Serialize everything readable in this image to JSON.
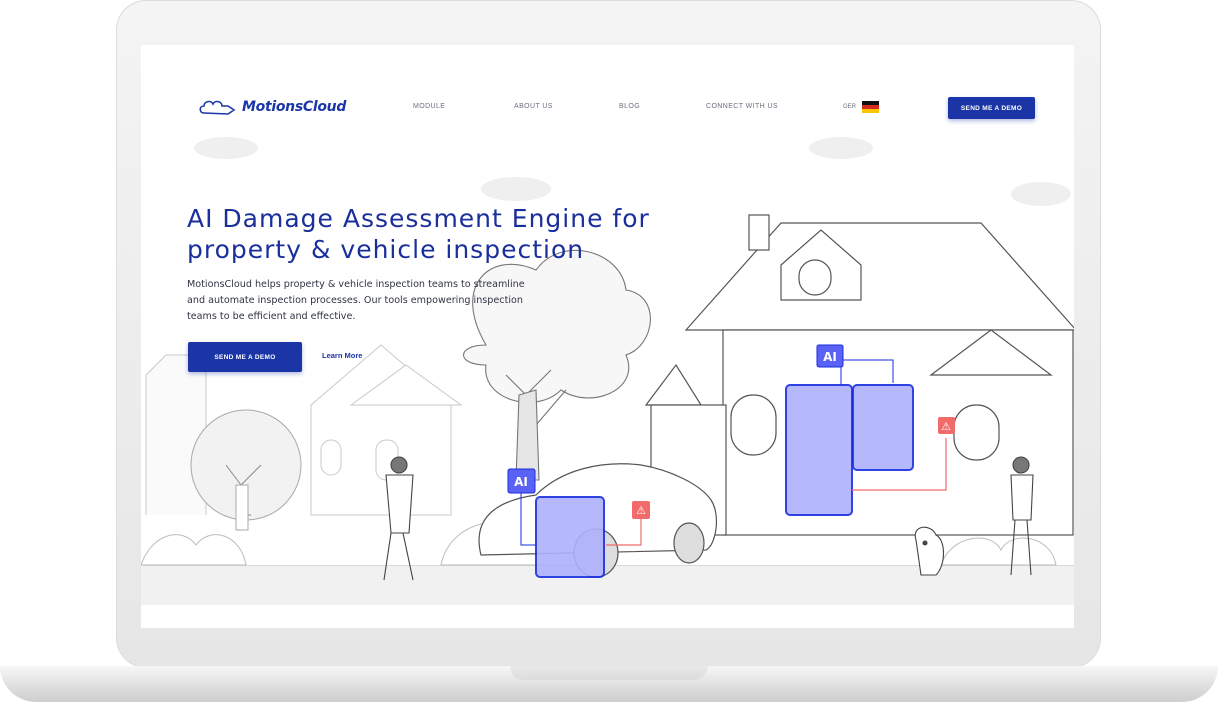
{
  "brand": {
    "name": "MotionsCloud",
    "color": "#1a36a8"
  },
  "nav": {
    "links": [
      {
        "label": "MODULE"
      },
      {
        "label": "ABOUT US"
      },
      {
        "label": "BLOG"
      },
      {
        "label": "CONNECT WITH US"
      }
    ],
    "language": "GER",
    "cta_label": "SEND ME A DEMO"
  },
  "hero": {
    "title_line1": "AI Damage Assessment Engine for",
    "title_line2": "property & vehicle inspection",
    "desc_line1": "MotionsCloud helps property & vehicle inspection teams to streamline",
    "desc_line2": "and automate inspection processes. Our tools empowering inspection",
    "desc_line3": "teams to be efficient and effective.",
    "primary_button": "SEND ME A DEMO",
    "secondary_link": "Learn More"
  },
  "illustration": {
    "ai_badge": "AI",
    "house_ai_badge": "AI",
    "warning_icon": "warning-triangle-icon",
    "accent": "#5a62f5",
    "alert": "#f26b6b"
  }
}
